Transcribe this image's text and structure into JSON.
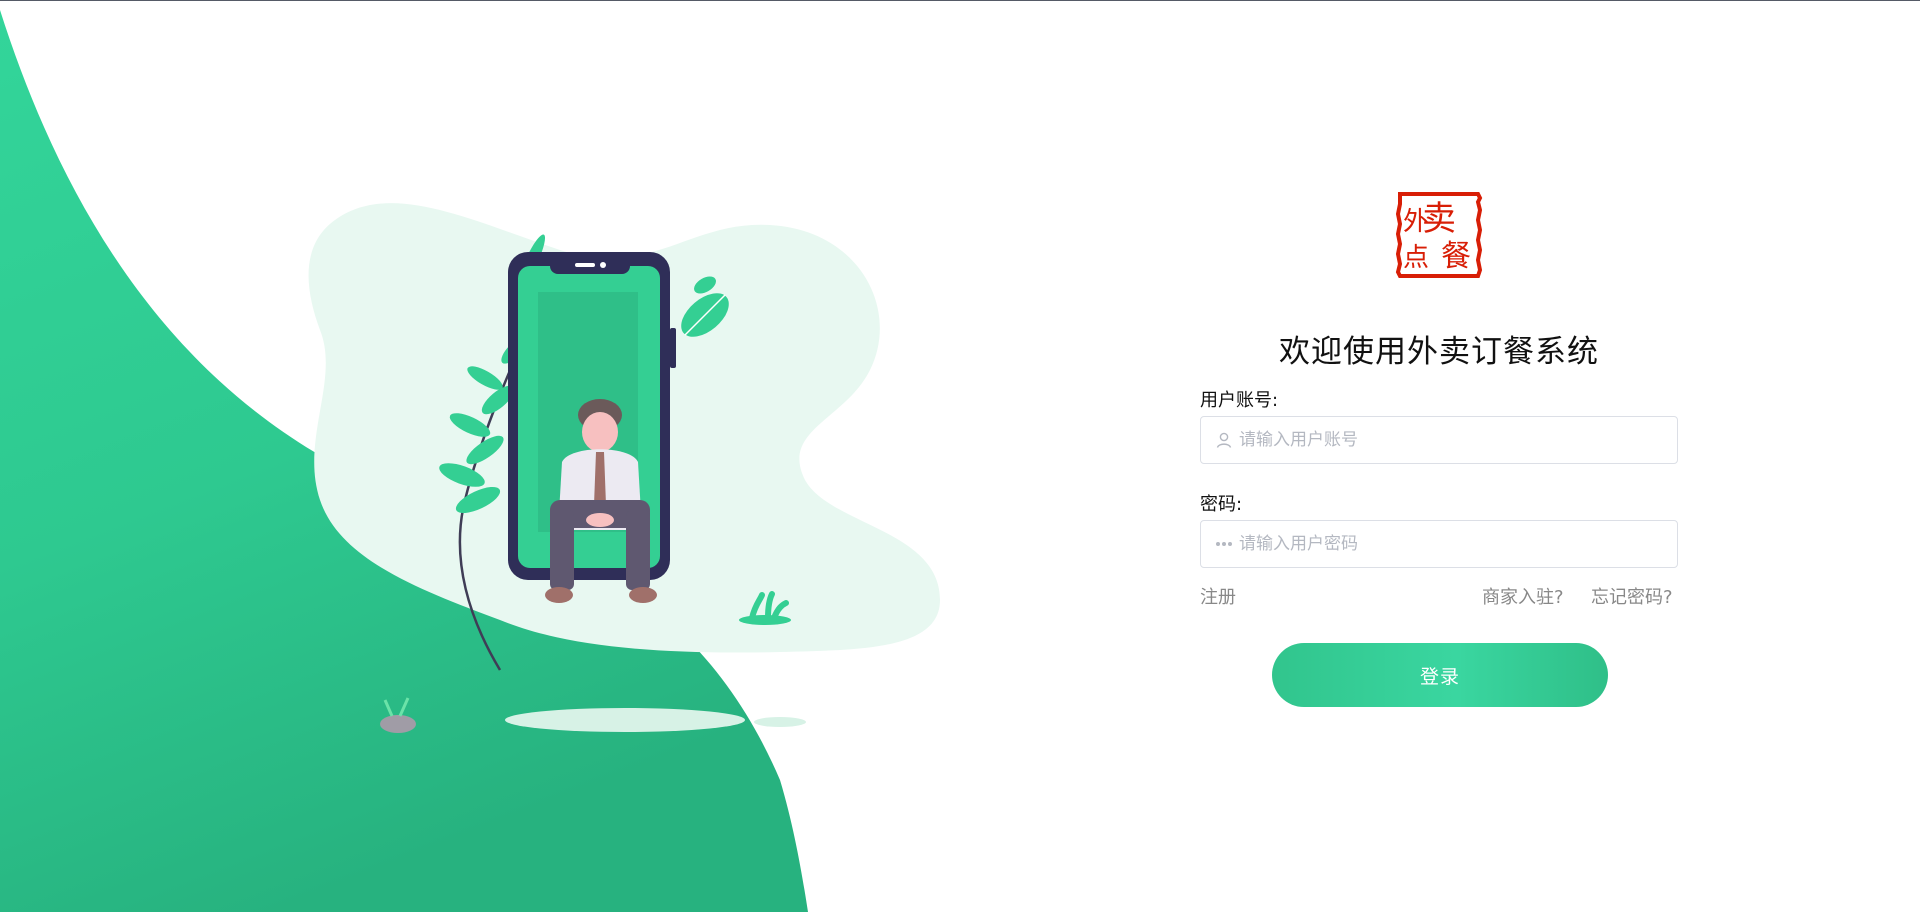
{
  "brand": {
    "logo_text": "外卖点餐",
    "logo_color": "#d81e06"
  },
  "colors": {
    "accent": "#2ecc91",
    "accent_light": "#e8f8f1"
  },
  "login": {
    "title": "欢迎使用外卖订餐系统",
    "username_label": "用户账号:",
    "username_placeholder": "请输入用户账号",
    "username_value": "",
    "password_label": "密码:",
    "password_placeholder": "请输入用户密码",
    "password_value": "",
    "register_link": "注册",
    "merchant_link": "商家入驻?",
    "forgot_link": "忘记密码?",
    "login_button": "登录"
  },
  "icons": {
    "username_icon": "user-icon",
    "password_icon": "password-dots-icon"
  }
}
